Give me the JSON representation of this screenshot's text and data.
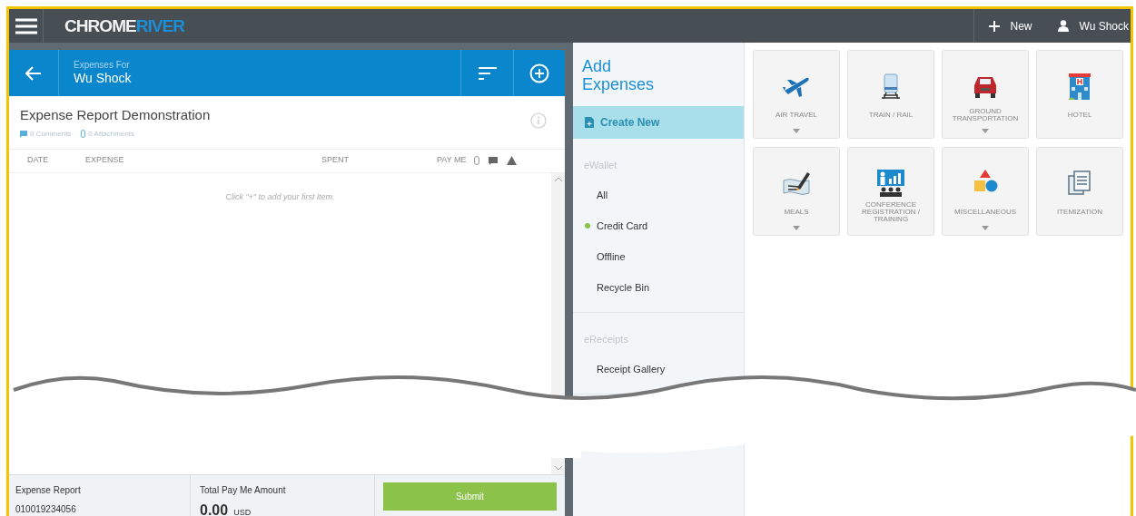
{
  "topbar": {
    "logo_left": "CHROME",
    "logo_right": "RIVER",
    "new_label": "New",
    "user_name": "Wu Shock"
  },
  "report_panel": {
    "header": {
      "subtitle": "Expenses For",
      "name": "Wu Shock"
    },
    "title": "Expense Report Demonstration",
    "comments": "0 Comments",
    "attachments": "0 Attachments",
    "columns": [
      "DATE",
      "EXPENSE",
      "SPENT",
      "PAY ME"
    ],
    "empty_hint": "Click \"+\" to add your first item.",
    "footer": {
      "report_label": "Expense Report",
      "report_number": "010019234056",
      "total_label": "Total Pay Me Amount",
      "total_amount": "0.00",
      "currency": "USD",
      "submit": "Submit"
    }
  },
  "sidebar": {
    "title_line1": "Add",
    "title_line2": "Expenses",
    "create_new": {
      "label": "Create New",
      "selected": true
    },
    "sections": [
      {
        "heading": "eWallet",
        "items": [
          {
            "label": "All",
            "marked": false
          },
          {
            "label": "Credit Card",
            "marked": true
          },
          {
            "label": "Offline",
            "marked": false
          },
          {
            "label": "Recycle Bin",
            "marked": false
          }
        ]
      },
      {
        "heading": "eReceipts",
        "items": [
          {
            "label": "Receipt Gallery",
            "marked": false
          }
        ]
      }
    ]
  },
  "tiles": [
    {
      "kind": "air",
      "label": "AIR TRAVEL",
      "has_menu": true
    },
    {
      "kind": "train",
      "label": "TRAIN / RAIL",
      "has_menu": false
    },
    {
      "kind": "car",
      "label": "GROUND TRANSPORTATION",
      "has_menu": true
    },
    {
      "kind": "hotel",
      "label": "HOTEL",
      "has_menu": false
    },
    {
      "kind": "meals",
      "label": "MEALS",
      "has_menu": true
    },
    {
      "kind": "conference",
      "label": "CONFERENCE REGISTRATION / TRAINING",
      "has_menu": false
    },
    {
      "kind": "misc",
      "label": "MISCELLANEOUS",
      "has_menu": true
    },
    {
      "kind": "itemization",
      "label": "ITEMIZATION",
      "has_menu": false
    }
  ]
}
